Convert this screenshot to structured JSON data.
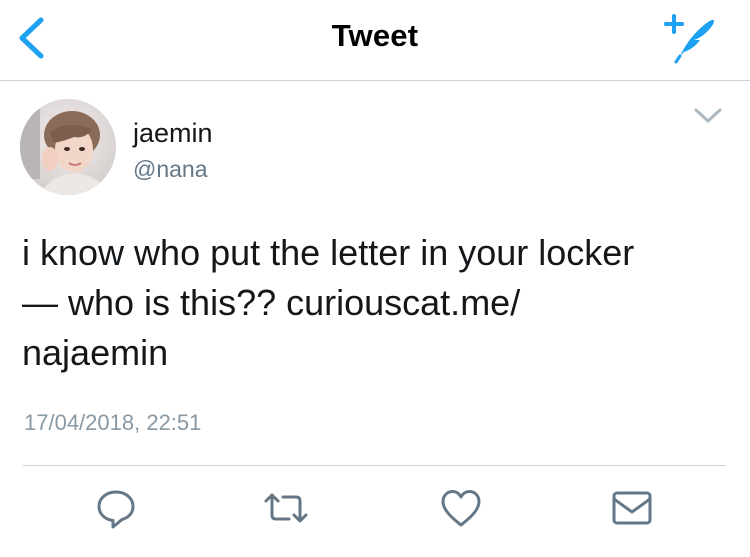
{
  "nav": {
    "title": "Tweet",
    "back_icon": "chevron-left-icon",
    "compose_icon": "compose-tweet-icon",
    "accent_color": "#1da1f2"
  },
  "tweet": {
    "display_name": "jaemin",
    "handle": "@nana",
    "text_lines": [
      "i know who put the letter in your locker",
      "— who is this?? curiouscat.me/",
      "najaemin"
    ],
    "timestamp": "17/04/2018, 22:51"
  },
  "actions": {
    "reply_icon": "reply-icon",
    "retweet_icon": "retweet-icon",
    "like_icon": "like-icon",
    "dm_icon": "direct-message-icon"
  }
}
